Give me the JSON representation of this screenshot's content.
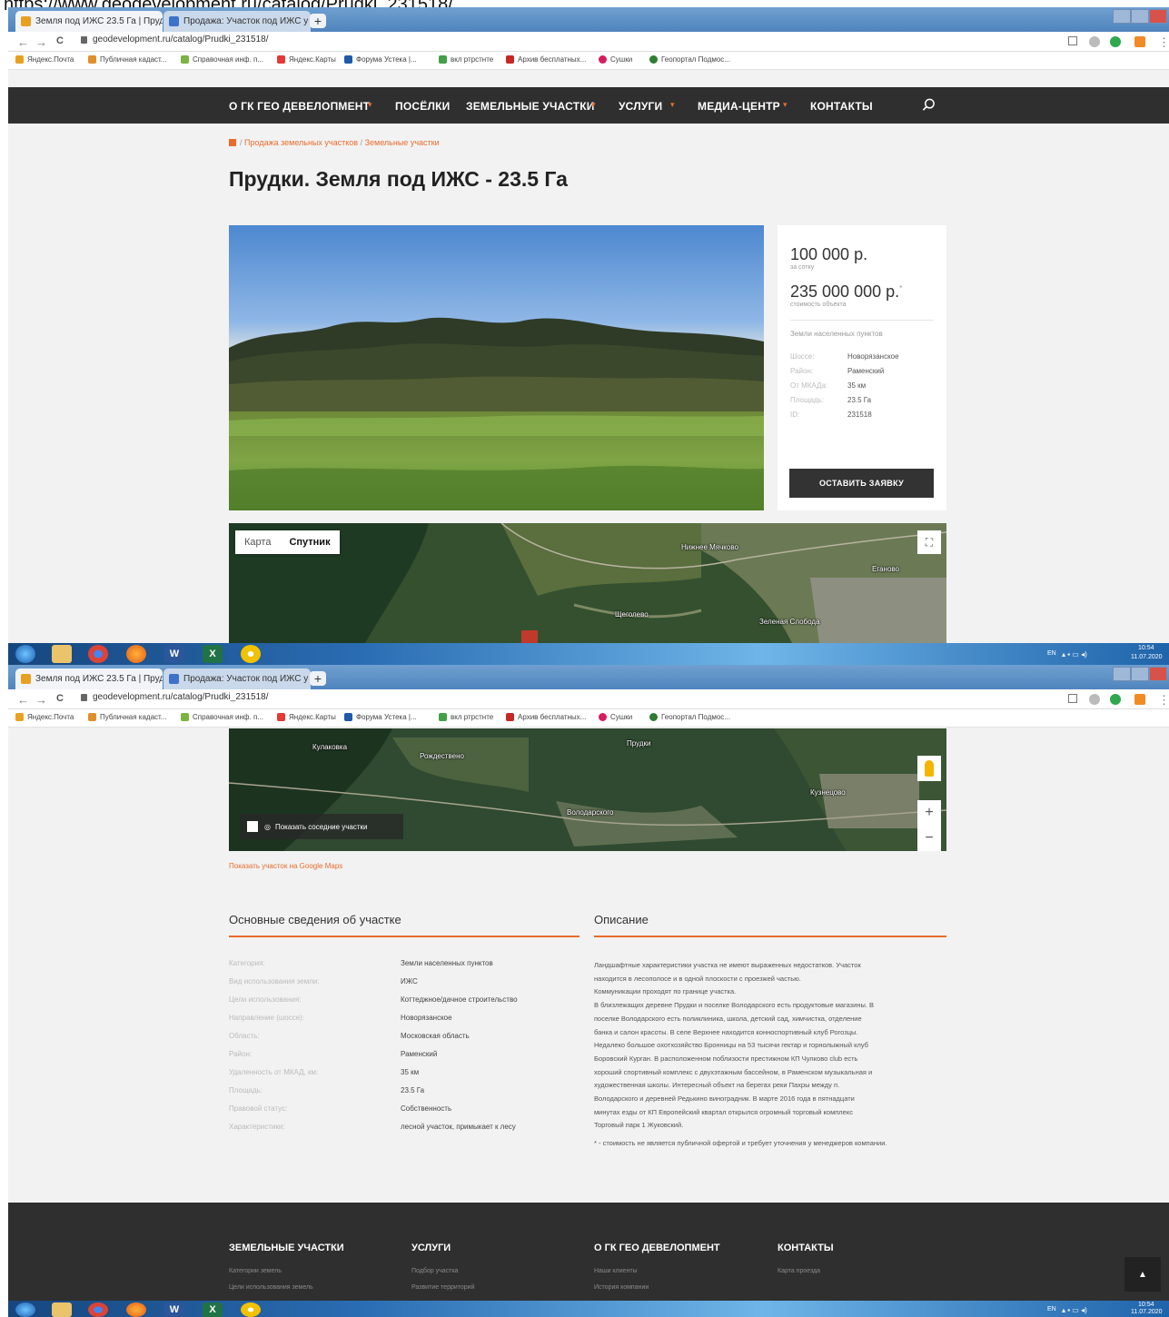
{
  "caption_url": "https://www.geodevelopment.ru/catalog/Prudki_231518/",
  "browser": {
    "tabs": [
      {
        "title": "Земля под ИЖС 23.5 Га | Прудк",
        "close": "×"
      },
      {
        "title": "Продажа: Участок под ИЖС у",
        "close": "×"
      }
    ],
    "new_tab": "+",
    "address": "geodevelopment.ru/catalog/Prudki_231518/",
    "back": "←",
    "forward": "→",
    "reload": "C",
    "bookmarks": [
      "Яндекс.Почта",
      "Публичная кадаст...",
      "Справочная инф. п...",
      "Яндекс.Карты",
      "Форума Устека |...",
      "вкл ртрстнте",
      "Архив бесплатных...",
      "Сушки",
      "Геопортал Подмос..."
    ],
    "colors": {
      "bookmark_icons": [
        "#e8a020",
        "#e0902a",
        "#7cb342",
        "#e53935",
        "#1e5aa8",
        "#43a047",
        "#c62828",
        "#d81b60",
        "#2e7d32"
      ]
    }
  },
  "nav": {
    "items": [
      {
        "label": "О ГК ГЕО ДЕВЕЛОПМЕНТ",
        "has_dropdown": true
      },
      {
        "label": "ПОСЁЛКИ",
        "has_dropdown": false
      },
      {
        "label": "ЗЕМЕЛЬНЫЕ УЧАСТКИ",
        "has_dropdown": true
      },
      {
        "label": "УСЛУГИ",
        "has_dropdown": true
      },
      {
        "label": "МЕДИА-ЦЕНТР",
        "has_dropdown": true
      },
      {
        "label": "КОНТАКТЫ",
        "has_dropdown": false
      }
    ],
    "caret": "▾",
    "search_icon": "search-icon"
  },
  "breadcrumb": {
    "sep": "/",
    "items": [
      "Продажа земельных участков",
      "Земельные участки"
    ]
  },
  "title": "Прудки. Земля под ИЖС - 23.5 Га",
  "offer": {
    "price_per": "100 000 р.",
    "price_per_sub": "за сотку",
    "price_total": "235 000 000 р.",
    "asterisk": "*",
    "price_total_sub": "стоимость объекта",
    "category": "Земли населенных пунктов",
    "details": [
      {
        "k": "Шоссе:",
        "v": "Новорязанское"
      },
      {
        "k": "Район:",
        "v": "Раменский"
      },
      {
        "k": "От МКАДа:",
        "v": "35 км"
      },
      {
        "k": "Площадь:",
        "v": "23.5 Га"
      },
      {
        "k": "ID:",
        "v": "231518"
      }
    ],
    "button": "ОСТАВИТЬ ЗАЯВКУ"
  },
  "map": {
    "tab_map": "Карта",
    "tab_satellite": "Спутник",
    "active": "Спутник",
    "labels_top": [
      "Нижнее Мячково",
      "Еганово",
      "Щеголево",
      "Зеленая Слобода"
    ],
    "labels_bottom": [
      "Кулаковка",
      "Прудки",
      "Рождествено",
      "Володарского",
      "Кузнецово"
    ],
    "zoom_in": "+",
    "zoom_out": "−",
    "show_neighbors": "Показать соседние участки",
    "google_link": "Показать участок на Google Maps"
  },
  "main_info": {
    "title": "Основные сведения об участке",
    "rows": [
      {
        "k": "Категория:",
        "v": "Земли населенных пунктов"
      },
      {
        "k": "Вид использования земли:",
        "v": "ИЖС"
      },
      {
        "k": "Цели использования:",
        "v": "Коттеджное/дачное строительство"
      },
      {
        "k": "Направление (шоссе):",
        "v": "Новорязанское"
      },
      {
        "k": "Область:",
        "v": "Московская область"
      },
      {
        "k": "Район:",
        "v": "Раменский"
      },
      {
        "k": "Удаленность от МКАД, км:",
        "v": "35 км"
      },
      {
        "k": "Площадь:",
        "v": "23.5 Га"
      },
      {
        "k": "Правовой статус:",
        "v": "Собственность"
      },
      {
        "k": "Характеристики:",
        "v": "лесной участок, примыкает к лесу"
      }
    ]
  },
  "description": {
    "title": "Описание",
    "lines": [
      "Ландшафтные характеристики участка не имеют выраженных недостатков. Участок",
      "находится в лесополосе и в одной плоскости с проезжей частью.",
      "Коммуникации проходят по границе участка.",
      "В близлежащих деревне Прудки и поселке Володарского есть продуктовые магазины. В",
      "поселке Володарского есть поликлиника, школа, детский сад, химчистка, отделение",
      "банка и салон красоты. В селе Верхнее находится конноспортивный клуб Рогозцы.",
      "Недалеко большое охотхозяйство Бронницы на 53 тысячи гектар и горнолыжный клуб",
      "Боровский Курган. В расположенном поблизости престижном КП Чулково club есть",
      "хороший спортивный комплекс с двухэтажным бассейном, в Раменском музыкальная и",
      "художественная школы. Интересный объект на берегах реки Пахры между п.",
      "Володарского и деревней Редькино виноградник. В марте 2016 года в пятнадцати",
      "минутах езды от КП Европейский квартал открылся огромный торговый комплекс",
      "Торговый парк 1 Жуковский."
    ],
    "footnote": "* - стоимость не является публичной офертой и требует уточнения у менеджеров компании."
  },
  "footer": {
    "columns": [
      {
        "title": "ЗЕМЕЛЬНЫЕ УЧАСТКИ",
        "items": [
          "Категории земель",
          "Цели использования земель"
        ]
      },
      {
        "title": "УСЛУГИ",
        "items": [
          "Подбор участка",
          "Развитие территорий"
        ]
      },
      {
        "title": "О ГК ГЕО ДЕВЕЛОПМЕНТ",
        "items": [
          "Наши клиенты",
          "История компании"
        ]
      },
      {
        "title": "КОНТАКТЫ",
        "items": [
          "Карта проезда"
        ]
      }
    ],
    "to_top": "▲"
  },
  "taskbar": {
    "lang": "EN",
    "time": "10:54",
    "date": "11.07.2020",
    "icons": [
      "start-orb-icon",
      "explorer-icon",
      "chrome-icon",
      "firefox-icon",
      "word-icon",
      "excel-icon",
      "yandex-browser-icon"
    ],
    "word_letter": "W",
    "excel_letter": "X"
  }
}
